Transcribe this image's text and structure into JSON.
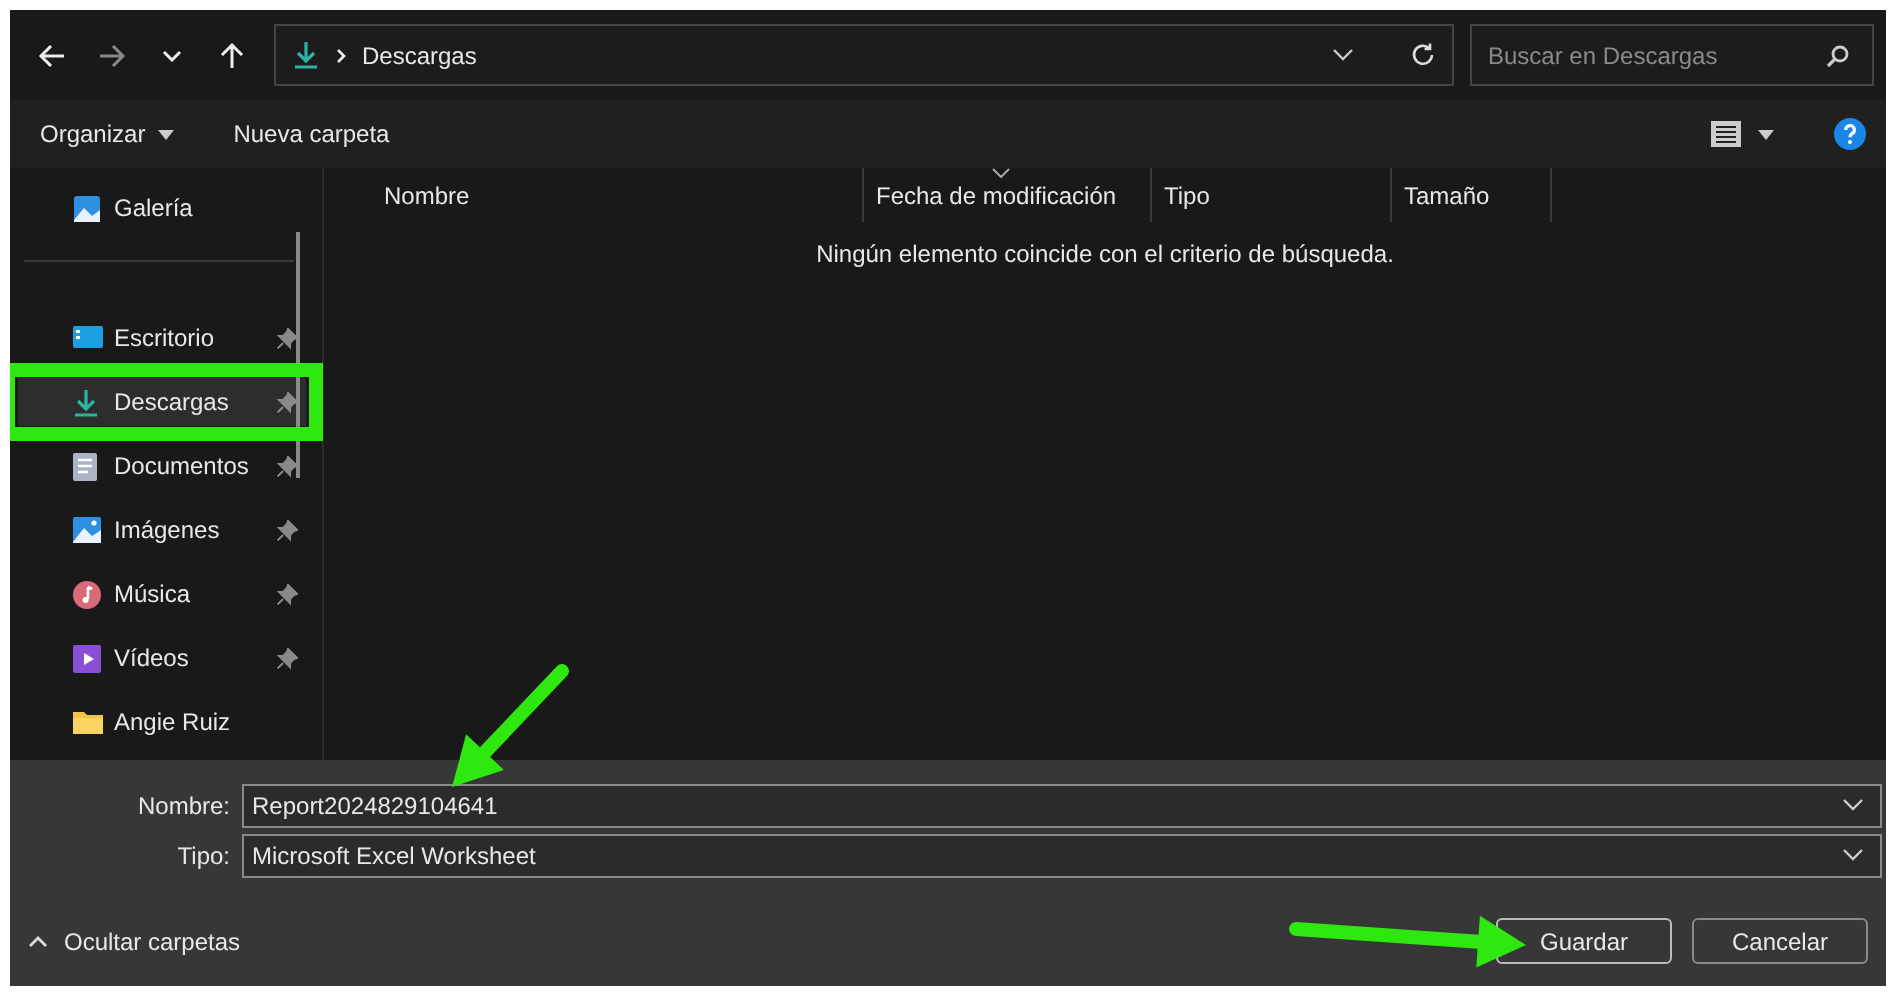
{
  "navigation": {
    "path": "Descargas",
    "search": {
      "placeholder": "Buscar en Descargas"
    }
  },
  "toolbar": {
    "organize": "Organizar",
    "new_folder": "Nueva carpeta"
  },
  "sidebar": {
    "items": [
      {
        "label": "Galería",
        "kind": "gallery",
        "pinned": false,
        "selected": false
      },
      {
        "kind": "divider"
      },
      {
        "label": "Escritorio",
        "kind": "desktop",
        "pinned": true,
        "selected": false
      },
      {
        "label": "Descargas",
        "kind": "download",
        "pinned": true,
        "selected": true
      },
      {
        "label": "Documentos",
        "kind": "documents",
        "pinned": true,
        "selected": false
      },
      {
        "label": "Imágenes",
        "kind": "images",
        "pinned": true,
        "selected": false
      },
      {
        "label": "Música",
        "kind": "music",
        "pinned": true,
        "selected": false
      },
      {
        "label": "Vídeos",
        "kind": "videos",
        "pinned": true,
        "selected": false
      },
      {
        "label": "Angie Ruiz",
        "kind": "folder",
        "pinned": false,
        "selected": false
      }
    ]
  },
  "table": {
    "columns": [
      {
        "label": "Nombre",
        "sorted": false
      },
      {
        "label": "Fecha de modificación",
        "sorted": true
      },
      {
        "label": "Tipo",
        "sorted": false
      },
      {
        "label": "Tamaño",
        "sorted": false
      }
    ],
    "empty_message": "Ningún elemento coincide con el criterio de búsqueda."
  },
  "form": {
    "fields": [
      {
        "label": "Nombre:",
        "value": "Report2024829104641"
      },
      {
        "label": "Tipo:",
        "value": "Microsoft Excel Worksheet"
      }
    ]
  },
  "footer": {
    "toggle": "Ocultar carpetas",
    "buttons": [
      {
        "label": "Guardar",
        "default": true
      },
      {
        "label": "Cancelar",
        "default": false
      }
    ]
  },
  "annotations": [
    {
      "kind": "box",
      "color": "#2ee80f"
    },
    {
      "kind": "arrow",
      "color": "#2ee80f"
    },
    {
      "kind": "arrow",
      "color": "#2ee80f"
    }
  ]
}
